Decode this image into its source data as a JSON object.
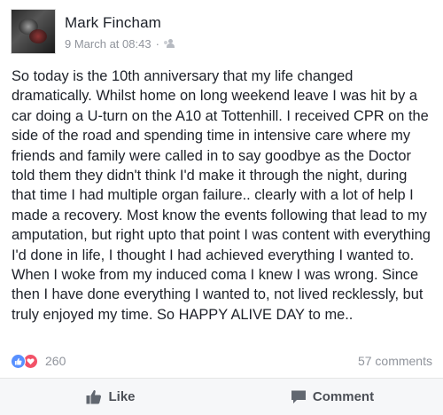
{
  "post": {
    "author": "Mark Fincham",
    "timestamp": "9 March at 08:43",
    "separator": "·",
    "audience_icon": "friends-icon",
    "text": "So today is the 10th anniversary that my life changed dramatically. Whilst home on long weekend leave I was hit by a car doing a U-turn on the A10 at Tottenhill. I received CPR on the side of the road and spending time in intensive care where my friends and family were called in to say goodbye as the Doctor told them they didn't think I'd make it through the night, during that time I had multiple organ failure.. clearly with a lot of help I made a recovery. Most know the events following that lead to my amputation, but right upto that point I was content with everything I'd done in life, I thought I had achieved everything I wanted to. When I woke from my induced coma I knew I was wrong. Since then I have done everything I wanted to, not lived recklessly, but truly enjoyed my time. So HAPPY ALIVE DAY to me.."
  },
  "stats": {
    "reactions": [
      "like",
      "love"
    ],
    "reaction_count": "260",
    "comments": "57 comments"
  },
  "actions": {
    "like_label": "Like",
    "comment_label": "Comment"
  },
  "colors": {
    "like_blue": "#5890ff",
    "love_red": "#f25268",
    "meta_gray": "#90949c",
    "action_gray": "#4b4f56"
  }
}
